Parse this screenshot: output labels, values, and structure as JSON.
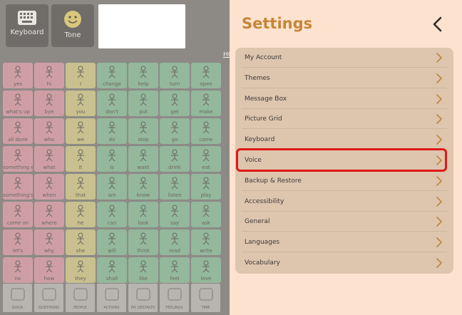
{
  "toolbar": {
    "keyboard_label": "Keyboard",
    "tone_label": "Tone",
    "home_label": "HO"
  },
  "grid": {
    "columns": [
      [
        "yes",
        "what's up",
        "all done",
        "something else",
        "something's wrong",
        "come on",
        "let's",
        "no"
      ],
      [
        "hi",
        "bye",
        "who",
        "what",
        "when",
        "where",
        "why",
        "how"
      ],
      [
        "I",
        "you",
        "we",
        "it",
        "that",
        "he",
        "she",
        "they"
      ],
      [
        "change",
        "don't",
        "do",
        "is",
        "am",
        "can",
        "will",
        "shall"
      ],
      [
        "help",
        "put",
        "stop",
        "want",
        "know",
        "look",
        "think",
        "like"
      ],
      [
        "turn",
        "get",
        "go",
        "drink",
        "listen",
        "say",
        "read",
        "feel"
      ],
      [
        "open",
        "make",
        "come",
        "eat",
        "play",
        "ask",
        "write",
        "love"
      ]
    ]
  },
  "bottom_bar": [
    "QUICK",
    "QUESTIONS",
    "PEOPLE",
    "ACTIONS",
    "MY GESTALTS",
    "FEELINGS",
    "TIME"
  ],
  "settings": {
    "title": "Settings",
    "items": [
      {
        "label": "My Account"
      },
      {
        "label": "Themes"
      },
      {
        "label": "Message Box"
      },
      {
        "label": "Picture Grid"
      },
      {
        "label": "Keyboard"
      },
      {
        "label": "Voice"
      },
      {
        "label": "Backup & Restore"
      },
      {
        "label": "Accessibility"
      },
      {
        "label": "General"
      },
      {
        "label": "Languages"
      },
      {
        "label": "Vocabulary"
      }
    ],
    "highlighted_item": "Voice",
    "colors": {
      "panel_bg": "#fde3cf",
      "title": "#c68537",
      "card_bg": "#ddc5ae",
      "highlight": "#e01818"
    }
  }
}
